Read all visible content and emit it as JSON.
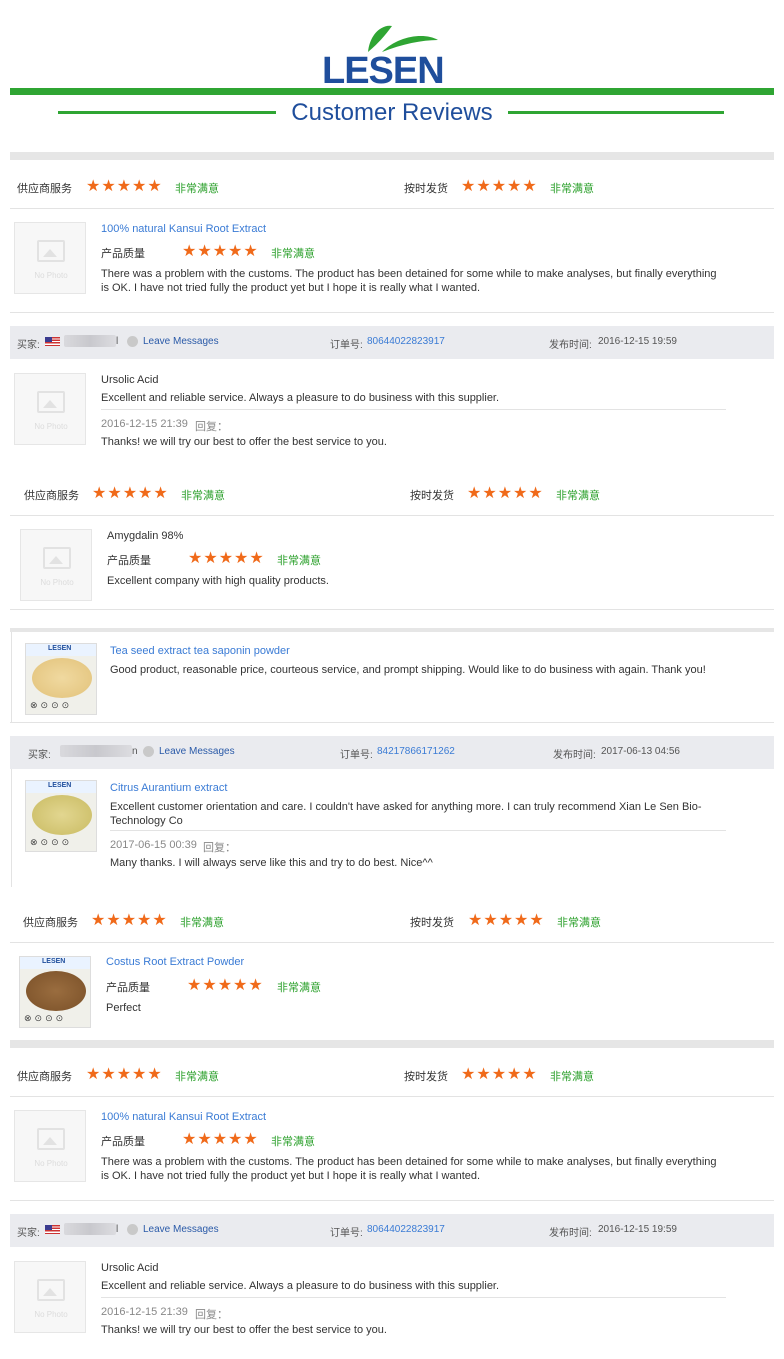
{
  "header": {
    "logo_text": "LESEN",
    "title": "Customer Reviews"
  },
  "labels": {
    "supplier_service": "供应商服务",
    "on_time": "按时发货",
    "product_quality": "产品质量",
    "very_satisfied": "非常满意",
    "buyer": "买家:",
    "leave_messages": "Leave Messages",
    "order_no": "订单号:",
    "published": "发布时间:",
    "reply": "回复：",
    "no_photo": "No Photo",
    "stars": "★★★★★"
  },
  "block1": {
    "product": "100% natural Kansui Root Extract",
    "review": "There was a problem with the customs. The product has been detained for some while to make analyses, but finally everything is OK. I have not tried fully the product yet but I hope it is really what I wanted."
  },
  "order1": {
    "buyer_suffix": "l",
    "order_number": "80644022823917",
    "date": "2016-12-15 19:59"
  },
  "block2": {
    "product": "Ursolic Acid",
    "review": "Excellent and reliable service. Always a pleasure to do business with this supplier.",
    "reply_date": "2016-12-15 21:39",
    "reply_text": "Thanks! we will try our best to offer the best service to you."
  },
  "block3": {
    "product": "Amygdalin 98%",
    "review": "Excellent company with high quality products."
  },
  "block4": {
    "product": "Tea seed extract tea saponin powder",
    "review": "Good product, reasonable price, courteous service, and prompt shipping.  Would like to do business with again. Thank you!"
  },
  "order2": {
    "buyer_suffix": "n",
    "order_number": "84217866171262",
    "date": "2017-06-13 04:56"
  },
  "block5": {
    "product": "Citrus Aurantium extract",
    "review": "Excellent customer orientation and care. I couldn't have asked for anything more. I can truly recommend Xian Le Sen Bio-Technology Co",
    "reply_date": "2017-06-15 00:39",
    "reply_text": "Many thanks. I will always serve like this and try to do best. Nice^^"
  },
  "block6": {
    "product": "Costus Root Extract Powder",
    "review": "Perfect"
  },
  "block7": {
    "product": "100% natural Kansui Root Extract",
    "review": "There was a problem with the customs. The product has been detained for some while to make analyses, but finally everything is OK. I have not tried fully the product yet but I hope it is really what I wanted."
  },
  "order3": {
    "buyer_suffix": "l",
    "order_number": "80644022823917",
    "date": "2016-12-15 19:59"
  },
  "block8": {
    "product": "Ursolic Acid",
    "review": "Excellent and reliable service. Always a pleasure to do business with this supplier.",
    "reply_date": "2016-12-15 21:39",
    "reply_text": "Thanks! we will try our best to offer the best service to you."
  },
  "colors": {
    "brand_blue": "#1f4e9c",
    "brand_green": "#2fa533",
    "star_orange": "#f06a1a",
    "link_blue": "#3a7bd5"
  }
}
